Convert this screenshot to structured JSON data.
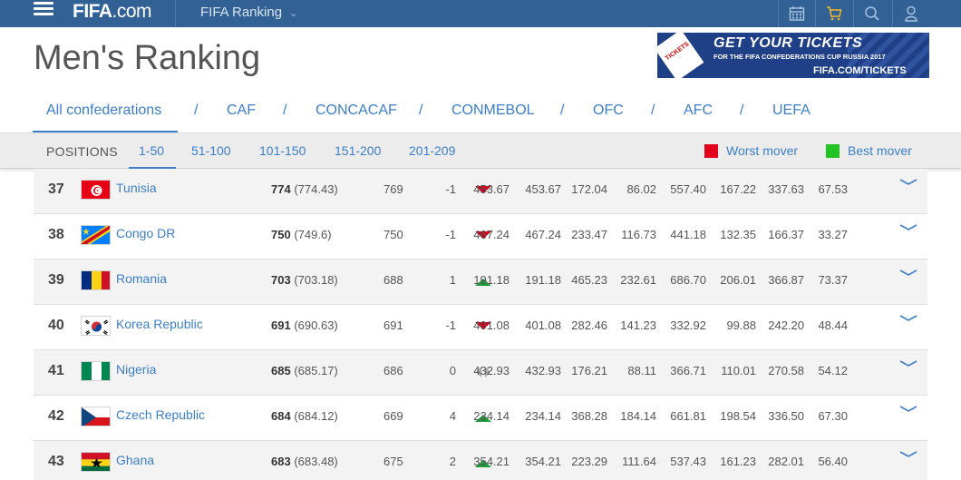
{
  "header": {
    "logo_main": "FIFA",
    "logo_suffix": ".com",
    "section": "FIFA Ranking",
    "icons": [
      "calendar-icon",
      "cart-icon",
      "search-icon",
      "user-icon"
    ]
  },
  "page_title": "Men's Ranking",
  "banner": {
    "ticket_text": "TICKETS",
    "headline": "GET YOUR TICKETS",
    "subline": "FOR THE FIFA CONFEDERATIONS CUP RUSSIA 2017",
    "url": "FIFA.COM/TICKETS"
  },
  "confederations": [
    "All confederations",
    "CAF",
    "CONCACAF",
    "CONMEBOL",
    "OFC",
    "AFC",
    "UEFA"
  ],
  "confederation_separator": "/",
  "positions": {
    "label": "POSITIONS",
    "ranges": [
      "1-50",
      "51-100",
      "101-150",
      "151-200",
      "201-209"
    ],
    "active_range": "1-50",
    "legend": {
      "worst_label": "Worst mover",
      "worst_color": "#e3001b",
      "best_label": "Best mover",
      "best_color": "#22c322"
    }
  },
  "colors": {
    "header_bg": "#326295",
    "link": "#3c7ec8",
    "down_arrow": "#d0021b",
    "up_arrow": "#1e9b3a",
    "neutral_arrow": "#aaaaaa"
  },
  "rows": [
    {
      "rank": "37",
      "country": "Tunisia",
      "flag": "tunisia",
      "points": "774",
      "points_exact": "(774.43)",
      "previous": "769",
      "movement": "-1",
      "trend": "down",
      "values": [
        "453.67",
        "453.67",
        "172.04",
        "86.02",
        "557.40",
        "167.22",
        "337.63",
        "67.53"
      ]
    },
    {
      "rank": "38",
      "country": "Congo DR",
      "flag": "congo-dr",
      "points": "750",
      "points_exact": "(749.6)",
      "previous": "750",
      "movement": "-1",
      "trend": "down",
      "values": [
        "467.24",
        "467.24",
        "233.47",
        "116.73",
        "441.18",
        "132.35",
        "166.37",
        "33.27"
      ]
    },
    {
      "rank": "39",
      "country": "Romania",
      "flag": "romania",
      "points": "703",
      "points_exact": "(703.18)",
      "previous": "688",
      "movement": "1",
      "trend": "up",
      "values": [
        "191.18",
        "191.18",
        "465.23",
        "232.61",
        "686.70",
        "206.01",
        "366.87",
        "73.37"
      ]
    },
    {
      "rank": "40",
      "country": "Korea Republic",
      "flag": "korea-republic",
      "points": "691",
      "points_exact": "(690.63)",
      "previous": "691",
      "movement": "-1",
      "trend": "down",
      "values": [
        "401.08",
        "401.08",
        "282.46",
        "141.23",
        "332.92",
        "99.88",
        "242.20",
        "48.44"
      ]
    },
    {
      "rank": "41",
      "country": "Nigeria",
      "flag": "nigeria",
      "points": "685",
      "points_exact": "(685.17)",
      "previous": "686",
      "movement": "0",
      "trend": "same",
      "values": [
        "432.93",
        "432.93",
        "176.21",
        "88.11",
        "366.71",
        "110.01",
        "270.58",
        "54.12"
      ]
    },
    {
      "rank": "42",
      "country": "Czech Republic",
      "flag": "czech-republic",
      "points": "684",
      "points_exact": "(684.12)",
      "previous": "669",
      "movement": "4",
      "trend": "up",
      "values": [
        "234.14",
        "234.14",
        "368.28",
        "184.14",
        "661.81",
        "198.54",
        "336.50",
        "67.30"
      ]
    },
    {
      "rank": "43",
      "country": "Ghana",
      "flag": "ghana",
      "points": "683",
      "points_exact": "(683.48)",
      "previous": "675",
      "movement": "2",
      "trend": "up",
      "values": [
        "354.21",
        "354.21",
        "223.29",
        "111.64",
        "537.43",
        "161.23",
        "282.01",
        "56.40"
      ]
    }
  ]
}
